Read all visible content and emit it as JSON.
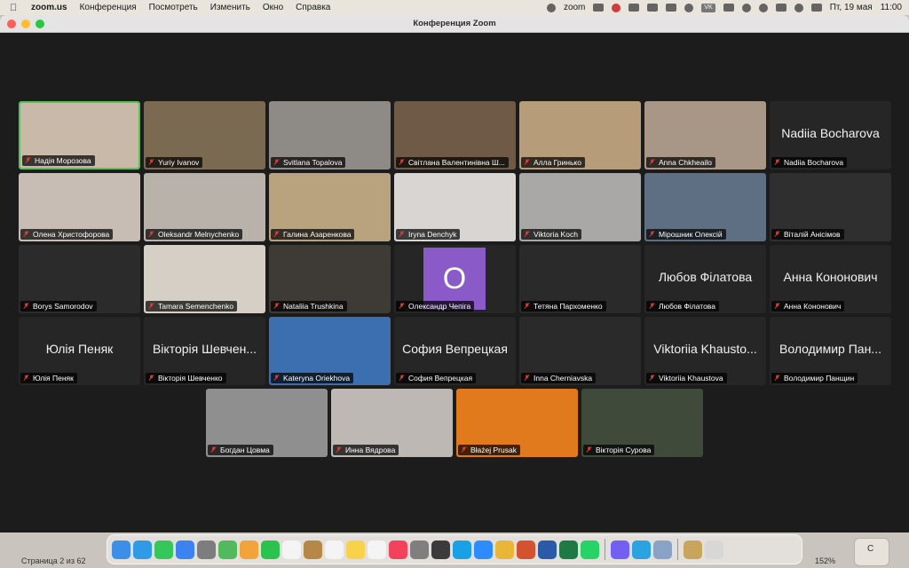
{
  "menubar": {
    "app": "zoom.us",
    "items": [
      "Конференция",
      "Посмотреть",
      "Изменить",
      "Окно",
      "Справка"
    ],
    "zoom_label": "zoom",
    "keyboard": "VK",
    "datetime_day": "Пт, 19 мая",
    "datetime_time": "11:00"
  },
  "window": {
    "title": "Конференция Zoom"
  },
  "participants": [
    {
      "name": "Надія Морозова",
      "type": "video",
      "bg": "#c9b9a8",
      "active": true
    },
    {
      "name": "Yuriy Ivanov",
      "type": "video",
      "bg": "#7a6a52"
    },
    {
      "name": "Svitlana Topalova",
      "type": "video",
      "bg": "#8e8a86"
    },
    {
      "name": "Світлана Валентинівна Ш...",
      "type": "video",
      "bg": "#6f5a48"
    },
    {
      "name": "Алла Гринько",
      "type": "video",
      "bg": "#b79c7a"
    },
    {
      "name": "Anna Chkheailo",
      "type": "video",
      "bg": "#a89786"
    },
    {
      "name": "Nadiia Bocharova",
      "type": "name",
      "big": "Nadiia Bocharova"
    },
    {
      "name": "Олена Христофорова",
      "type": "video",
      "bg": "#c7bdb5"
    },
    {
      "name": "Oleksandr Melnychenko",
      "type": "video",
      "bg": "#b8b2aa"
    },
    {
      "name": "Галина Азаренкова",
      "type": "video",
      "bg": "#b9a27e"
    },
    {
      "name": "Iryna Denchyk",
      "type": "video",
      "bg": "#d8d5d2"
    },
    {
      "name": "Viktoria Koch",
      "type": "video",
      "bg": "#a9a8a6"
    },
    {
      "name": "Мірошник Олексій",
      "type": "video",
      "bg": "#5e6f84"
    },
    {
      "name": "Віталій Анісімов",
      "type": "video",
      "bg": "#2f2f2f"
    },
    {
      "name": "Borys Samorodov",
      "type": "video",
      "bg": "#2b2b2b"
    },
    {
      "name": "Tamara Semenchenko",
      "type": "video",
      "bg": "#d6cfc6"
    },
    {
      "name": "Nataliia Trushkina",
      "type": "video",
      "bg": "#3e3a36"
    },
    {
      "name": "Олександр Чепіга",
      "type": "avatar",
      "initial": "O"
    },
    {
      "name": "Тетяна Пархоменко",
      "type": "video",
      "bg": "#2a2a2a"
    },
    {
      "name": "Любов Філатова",
      "type": "name",
      "big": "Любов Філатова"
    },
    {
      "name": "Анна Кононович",
      "type": "name",
      "big": "Анна Кононович"
    },
    {
      "name": "Юлія Пеняк",
      "type": "name",
      "big": "Юлія Пеняк"
    },
    {
      "name": "Вікторія Шевченко",
      "type": "name",
      "big": "Вікторія Шевчен..."
    },
    {
      "name": "Kateryna Oriekhova",
      "type": "video",
      "bg": "#3b6fb0"
    },
    {
      "name": "София Вепрецкая",
      "type": "name",
      "big": "София Вепрецкая"
    },
    {
      "name": "Inna Cherniavska",
      "type": "video",
      "bg": "#2a2a2a"
    },
    {
      "name": "Viktoriia Khaustova",
      "type": "name",
      "big": "Viktoriia Khausto..."
    },
    {
      "name": "Володимир Панщин",
      "type": "name",
      "big": "Володимир Пан..."
    },
    {
      "name": "Богдан Цовма",
      "type": "video",
      "bg": "#8f8f8f"
    },
    {
      "name": "Инна Вядрова",
      "type": "video",
      "bg": "#bdb8b3"
    },
    {
      "name": "Błażej Prusak",
      "type": "video",
      "bg": "#e07a1c"
    },
    {
      "name": "Вікторія Сурова",
      "type": "video",
      "bg": "#3f4a3a"
    }
  ],
  "statusbar": {
    "page": "Страница 2 из 62",
    "zoom_level": "152%"
  },
  "colors": {
    "active_speaker": "#54c354",
    "muted_icon": "#e23b3b",
    "avatar_bg": "#8a5ac8"
  }
}
